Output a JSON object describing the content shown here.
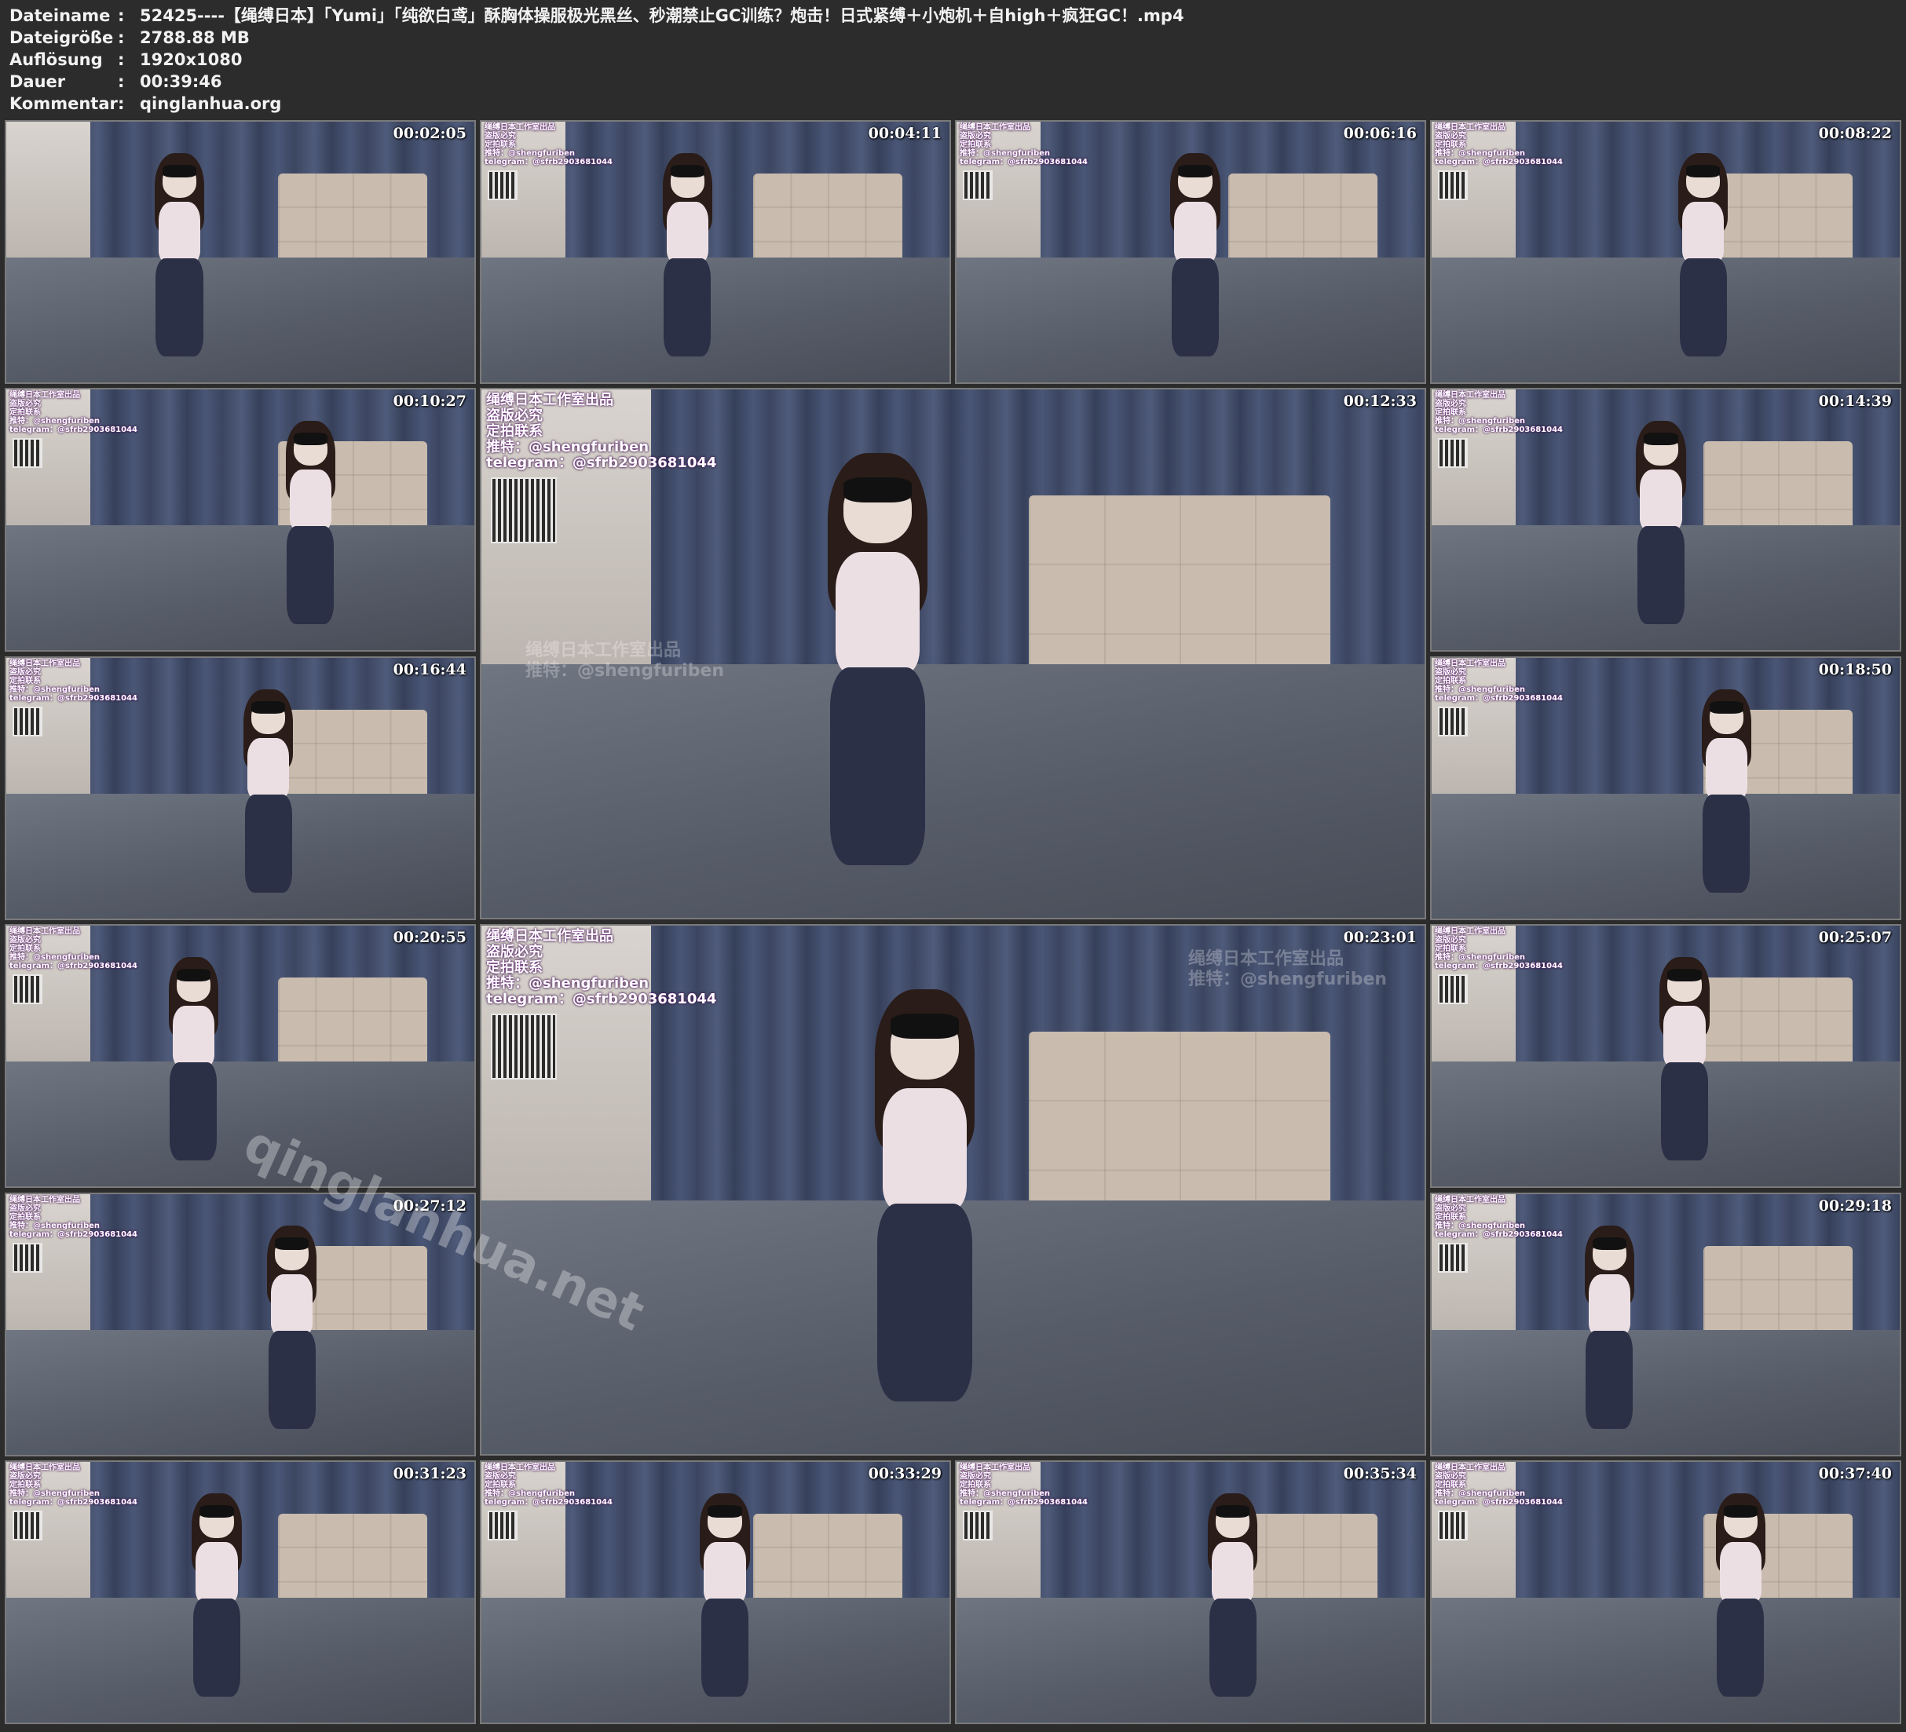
{
  "info": [
    {
      "key": "Dateiname",
      "sep": ":",
      "value": "52425----【绳缚日本】「Yumi」「纯欲白鸢」酥胸体操服极光黑丝、秒潮禁止GC训练？炮击！日式紧缚＋小炮机＋自high＋疯狂GC！.mp4"
    },
    {
      "key": "Dateigröße",
      "sep": ":",
      "value": "2788.88 MB"
    },
    {
      "key": "Auflösung",
      "sep": ":",
      "value": "1920x1080"
    },
    {
      "key": "Dauer",
      "sep": ":",
      "value": "00:39:46"
    },
    {
      "key": "Kommentar",
      "sep": ":",
      "value": "qinglanhua.org"
    }
  ],
  "overlay_small": [
    "绳缚日本工作室出品",
    "盗版必究",
    "定拍联系",
    "推特：@shengfuriben",
    "telegram：@sfrb2903681044"
  ],
  "overlay_big": [
    "绳缚日本工作室出品",
    "盗版必究",
    "定拍联系",
    "推特：@shengfuriben",
    "telegram：@sfrb2903681044"
  ],
  "faint_a": [
    "绳缚日本工作室出品",
    "推特：@shengfuriben"
  ],
  "faint_b": [
    "绳缚日本工作室出品",
    "推特：@shengfuriben"
  ],
  "site_mark": "qinglanhua.net",
  "frames": [
    {
      "time": "00:02:05"
    },
    {
      "time": "00:04:11"
    },
    {
      "time": "00:06:16"
    },
    {
      "time": "00:08:22"
    },
    {
      "time": "00:10:27"
    },
    {
      "time": "00:12:33"
    },
    {
      "time": "00:14:39"
    },
    {
      "time": "00:16:44"
    },
    {
      "time": "00:18:50"
    },
    {
      "time": "00:20:55"
    },
    {
      "time": "00:23:01"
    },
    {
      "time": "00:25:07"
    },
    {
      "time": "00:27:12"
    },
    {
      "time": "00:29:18"
    },
    {
      "time": "00:31:23"
    },
    {
      "time": "00:33:29"
    },
    {
      "time": "00:35:34"
    },
    {
      "time": "00:37:40"
    }
  ]
}
